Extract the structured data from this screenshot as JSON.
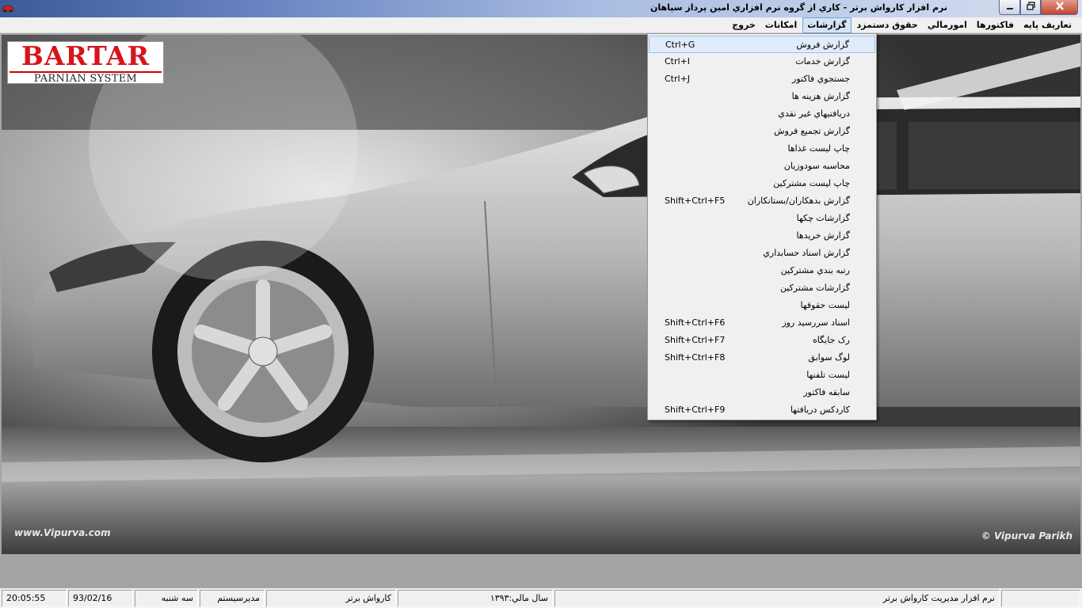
{
  "window": {
    "title": "نرم افزار كارواش برتر - كاري از گروه نرم افزاري امين پرداز سپاهان",
    "icon": "car-icon",
    "colors": {
      "accent": "#3a5a9a",
      "close": "#c2432d"
    }
  },
  "menubar": {
    "items": [
      {
        "label": "تعاريف پايه"
      },
      {
        "label": "فاكتورها"
      },
      {
        "label": "امورمالي"
      },
      {
        "label": "حقوق دستمزد"
      },
      {
        "label": "گزارشات",
        "active": true
      },
      {
        "label": "امكانات"
      },
      {
        "label": "خروج"
      }
    ]
  },
  "logo": {
    "brand": "BARTAR",
    "subtitle": "PARNIAN SYSTEM",
    "color": "#d8141b"
  },
  "watermarks": {
    "left": "www.Vipurva.com",
    "right": "© Vipurva Parikh"
  },
  "reports_menu": {
    "items": [
      {
        "label": "گزارش فروش",
        "shortcut": "Ctrl+G",
        "highlighted": true
      },
      {
        "label": "گزارش خدمات",
        "shortcut": "Ctrl+I"
      },
      {
        "label": "جستجوي فاكتور",
        "shortcut": "Ctrl+J"
      },
      {
        "label": "گزارش هزينه ها",
        "shortcut": ""
      },
      {
        "label": "دريافتيهاي غير نقدي",
        "shortcut": ""
      },
      {
        "label": "گزارش تجميع فروش",
        "shortcut": ""
      },
      {
        "label": "چاپ ليست غذاها",
        "shortcut": ""
      },
      {
        "label": "محاسبه سودوزيان",
        "shortcut": ""
      },
      {
        "label": "چاپ ليست مشتركين",
        "shortcut": ""
      },
      {
        "label": "گزارش بدهكاران/بستانكاران",
        "shortcut": "Shift+Ctrl+F5"
      },
      {
        "label": "گزارشات چكها",
        "shortcut": ""
      },
      {
        "label": "گزارش خريدها",
        "shortcut": ""
      },
      {
        "label": "گزارش اسناد حسابداري",
        "shortcut": ""
      },
      {
        "label": "رتبه بندي مشتركين",
        "shortcut": ""
      },
      {
        "label": "گزارشات مشتركين",
        "shortcut": ""
      },
      {
        "label": "ليست حقوقها",
        "shortcut": ""
      },
      {
        "label": "اسناد سررسيد روز",
        "shortcut": "Shift+Ctrl+F6"
      },
      {
        "label": "رک جايگاه",
        "shortcut": "Shift+Ctrl+F7"
      },
      {
        "label": "لوگ سوابق",
        "shortcut": "Shift+Ctrl+F8"
      },
      {
        "label": "ليست تلفنها",
        "shortcut": ""
      },
      {
        "label": "سابقه فاكتور",
        "shortcut": ""
      },
      {
        "label": "كاردكس دريافتها",
        "shortcut": "Shift+Ctrl+F9"
      }
    ]
  },
  "statusbar": {
    "time": "20:05:55",
    "date": "93/02/16",
    "weekday": "سه شنبه",
    "user": "مديرسيستم",
    "company": "كارواش برتر",
    "fiscal_year": "سال مالي:۱۳۹۳",
    "app_name": "نرم افزار مديريت كارواش برتر"
  }
}
